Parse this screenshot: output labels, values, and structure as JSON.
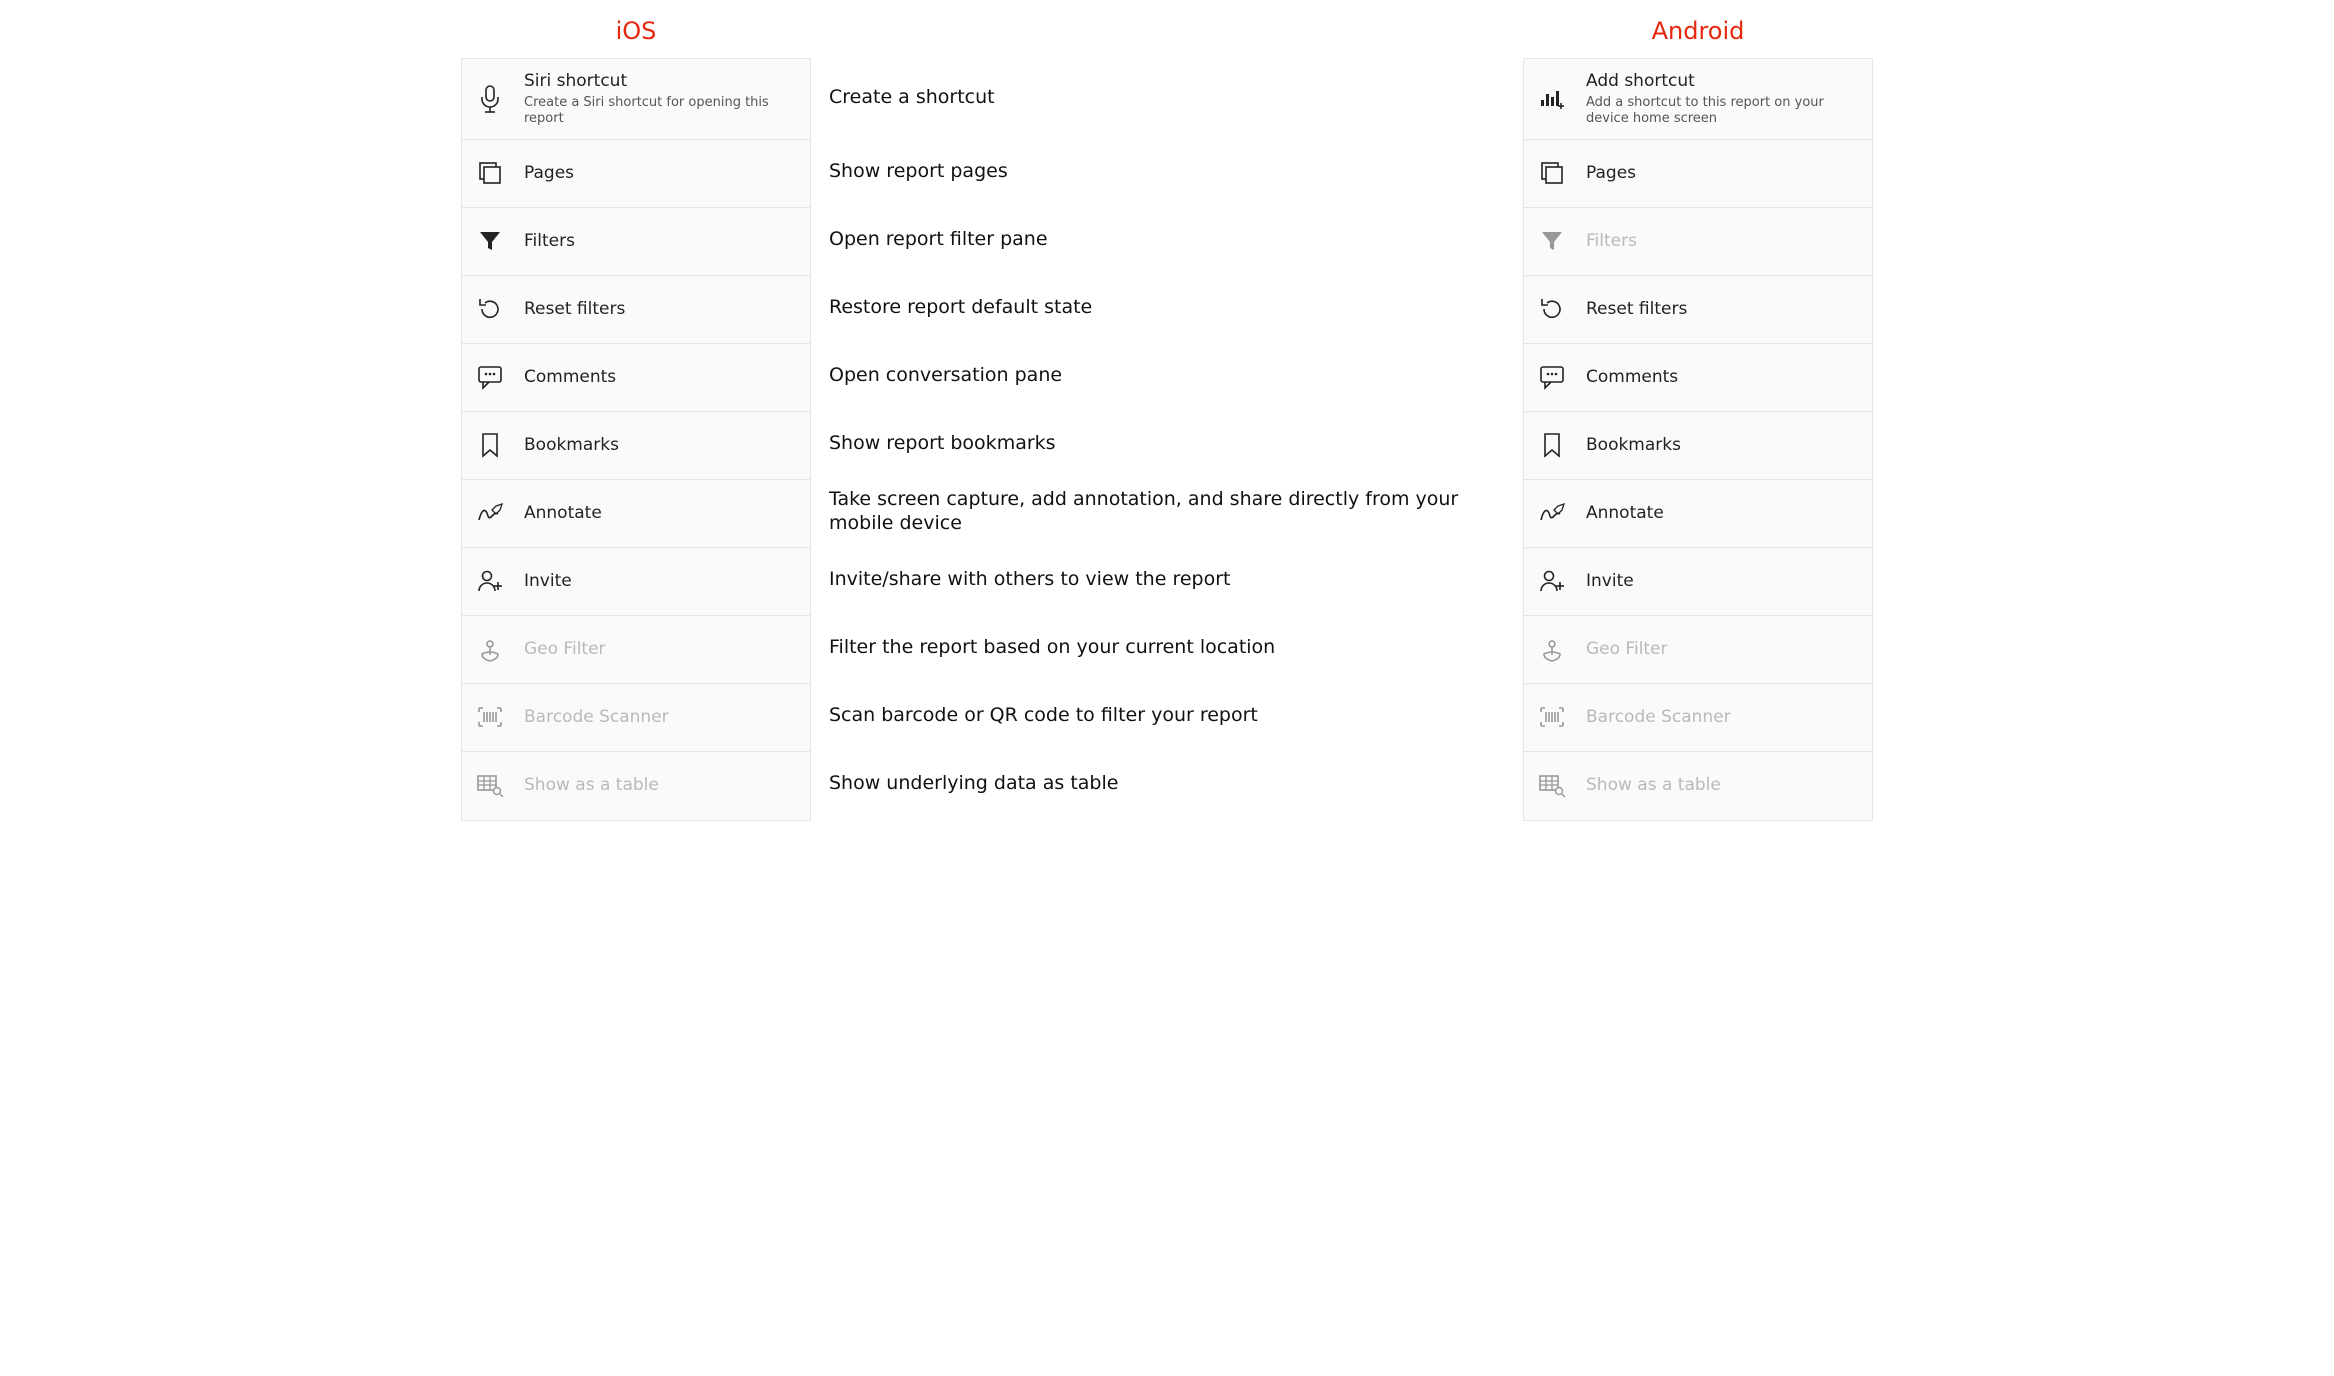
{
  "headings": {
    "ios": "iOS",
    "android": "Android"
  },
  "descriptions": [
    "Create a shortcut",
    "Show report pages",
    "Open report filter pane",
    "Restore report default state",
    "Open conversation pane",
    "Show report bookmarks",
    "Take screen capture, add annotation, and share directly from your mobile device",
    "Invite/share with others to view the report",
    "Filter the report based on your current location",
    "Scan barcode or QR code to filter your report",
    "Show underlying data as table"
  ],
  "ios": [
    {
      "icon": "mic",
      "label": "Siri shortcut",
      "sub": "Create a Siri shortcut for opening this report",
      "disabled": false
    },
    {
      "icon": "pages",
      "label": "Pages",
      "disabled": false
    },
    {
      "icon": "filter",
      "label": "Filters",
      "disabled": false
    },
    {
      "icon": "reset",
      "label": "Reset filters",
      "disabled": false
    },
    {
      "icon": "comment",
      "label": "Comments",
      "disabled": false
    },
    {
      "icon": "bookmark",
      "label": "Bookmarks",
      "disabled": false
    },
    {
      "icon": "annotate",
      "label": "Annotate",
      "disabled": false
    },
    {
      "icon": "invite",
      "label": "Invite",
      "disabled": false
    },
    {
      "icon": "geo",
      "label": "Geo Filter",
      "disabled": true
    },
    {
      "icon": "barcode",
      "label": "Barcode Scanner",
      "disabled": true
    },
    {
      "icon": "table",
      "label": "Show as a table",
      "disabled": true
    }
  ],
  "android": [
    {
      "icon": "addshortcut",
      "label": "Add shortcut",
      "sub": "Add a shortcut to this report on your device home screen",
      "disabled": false
    },
    {
      "icon": "pages",
      "label": "Pages",
      "disabled": false
    },
    {
      "icon": "filter",
      "label": "Filters",
      "disabled": true
    },
    {
      "icon": "reset",
      "label": "Reset filters",
      "disabled": false
    },
    {
      "icon": "comment",
      "label": "Comments",
      "disabled": false
    },
    {
      "icon": "bookmark",
      "label": "Bookmarks",
      "disabled": false
    },
    {
      "icon": "annotate",
      "label": "Annotate",
      "disabled": false
    },
    {
      "icon": "invite",
      "label": "Invite",
      "disabled": false
    },
    {
      "icon": "geo",
      "label": "Geo Filter",
      "disabled": true
    },
    {
      "icon": "barcode",
      "label": "Barcode Scanner",
      "disabled": true
    },
    {
      "icon": "table",
      "label": "Show as a table",
      "disabled": true
    }
  ]
}
